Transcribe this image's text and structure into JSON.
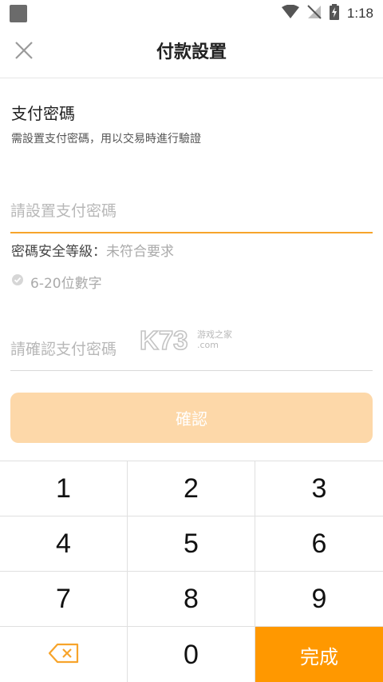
{
  "status_bar": {
    "time": "1:18"
  },
  "header": {
    "title": "付款設置"
  },
  "section": {
    "title": "支付密碼",
    "description": "需設置支付密碼，用以交易時進行驗證"
  },
  "password_field": {
    "placeholder": "請設置支付密碼",
    "value": ""
  },
  "security": {
    "label": "密碼安全等級：",
    "value": "未符合要求"
  },
  "rule": {
    "text": "6-20位數字"
  },
  "confirm_field": {
    "placeholder": "請確認支付密碼",
    "value": ""
  },
  "confirm_button": {
    "label": "確認"
  },
  "watermark": {
    "brand": "K73",
    "sub1": "游戏之家",
    "sub2": ".com"
  },
  "keypad": {
    "keys": [
      "1",
      "2",
      "3",
      "4",
      "5",
      "6",
      "7",
      "8",
      "9"
    ],
    "zero": "0",
    "done": "完成"
  },
  "colors": {
    "accent": "#ff9800",
    "underline_active": "#f7a42b",
    "button_disabled": "#fdd8a9"
  }
}
